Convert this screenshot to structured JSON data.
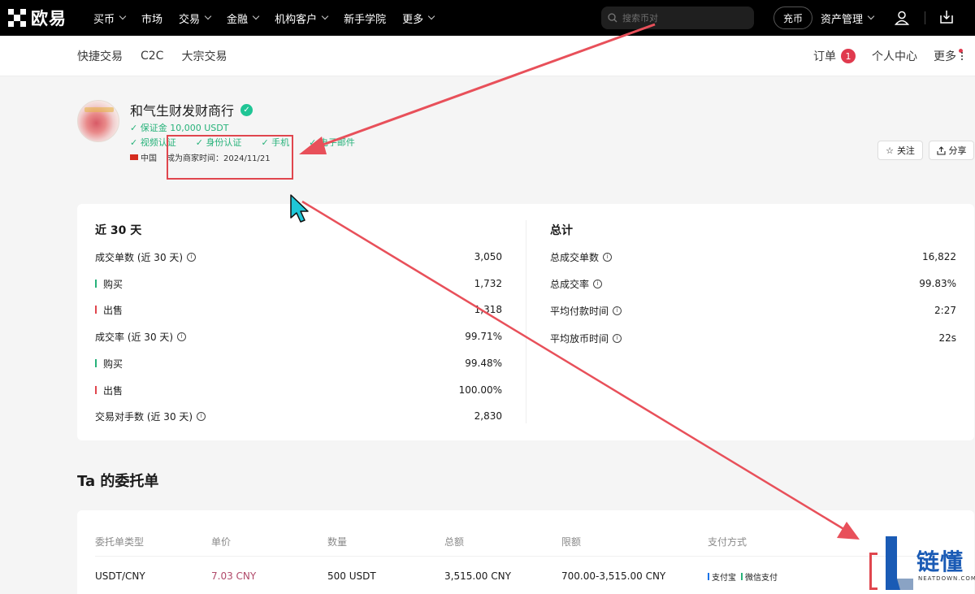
{
  "nav": {
    "brand": "欧易",
    "items": [
      {
        "label": "买币",
        "dropdown": true
      },
      {
        "label": "市场",
        "dropdown": false
      },
      {
        "label": "交易",
        "dropdown": true
      },
      {
        "label": "金融",
        "dropdown": true
      },
      {
        "label": "机构客户",
        "dropdown": true
      },
      {
        "label": "新手学院",
        "dropdown": false
      },
      {
        "label": "更多",
        "dropdown": true
      }
    ],
    "search_placeholder": "搜索币对",
    "deposit": "充币",
    "asset_management": "资产管理"
  },
  "subnav": {
    "left": [
      "快捷交易",
      "C2C",
      "大宗交易"
    ],
    "orders": "订单",
    "orders_badge": "1",
    "personal_center": "个人中心",
    "more": "更多"
  },
  "profile": {
    "name": "和气生财发财商行",
    "deposit": "保证金 10,000 USDT",
    "verifications": [
      "视频认证",
      "身份认证",
      "手机",
      "电子邮件"
    ],
    "country": "中国",
    "merchant_since_label": "成为商家时间：",
    "merchant_since": "2024/11/21",
    "follow": "关注",
    "share": "分享"
  },
  "stats": {
    "recent": {
      "title": "近 30 天",
      "rows": [
        {
          "label": "成交单数 (近 30 天)",
          "value": "3,050",
          "info": true,
          "marker": ""
        },
        {
          "label": "购买",
          "value": "1,732",
          "info": false,
          "marker": "green"
        },
        {
          "label": "出售",
          "value": "1,318",
          "info": false,
          "marker": "red"
        },
        {
          "label": "成交率 (近 30 天)",
          "value": "99.71%",
          "info": true,
          "marker": ""
        },
        {
          "label": "购买",
          "value": "99.48%",
          "info": false,
          "marker": "green"
        },
        {
          "label": "出售",
          "value": "100.00%",
          "info": false,
          "marker": "red"
        },
        {
          "label": "交易对手数 (近 30 天)",
          "value": "2,830",
          "info": true,
          "marker": ""
        }
      ]
    },
    "total": {
      "title": "总计",
      "rows": [
        {
          "label": "总成交单数",
          "value": "16,822",
          "info": true
        },
        {
          "label": "总成交率",
          "value": "99.83%",
          "info": true
        },
        {
          "label": "平均付款时间",
          "value": "2:27",
          "info": true
        },
        {
          "label": "平均放币时间",
          "value": "22s",
          "info": true
        }
      ]
    }
  },
  "orders": {
    "title": "Ta 的委托单",
    "headers": [
      "委托单类型",
      "单价",
      "数量",
      "总额",
      "限额",
      "支付方式"
    ],
    "rows": [
      {
        "type": "USDT/CNY",
        "price": "7.03 CNY",
        "quantity": "500 USDT",
        "total": "3,515.00 CNY",
        "limit": "700.00-3,515.00 CNY",
        "payments": [
          {
            "name": "支付宝",
            "color": "#1a73e8"
          },
          {
            "name": "微信支付",
            "color": "#27b27a"
          }
        ]
      }
    ]
  },
  "watermark": {
    "text": "链懂",
    "sub": "NEATDOWN.COM"
  },
  "colors": {
    "accent_red": "#e0464e",
    "green": "#27b27a",
    "price": "#b14a6a"
  }
}
